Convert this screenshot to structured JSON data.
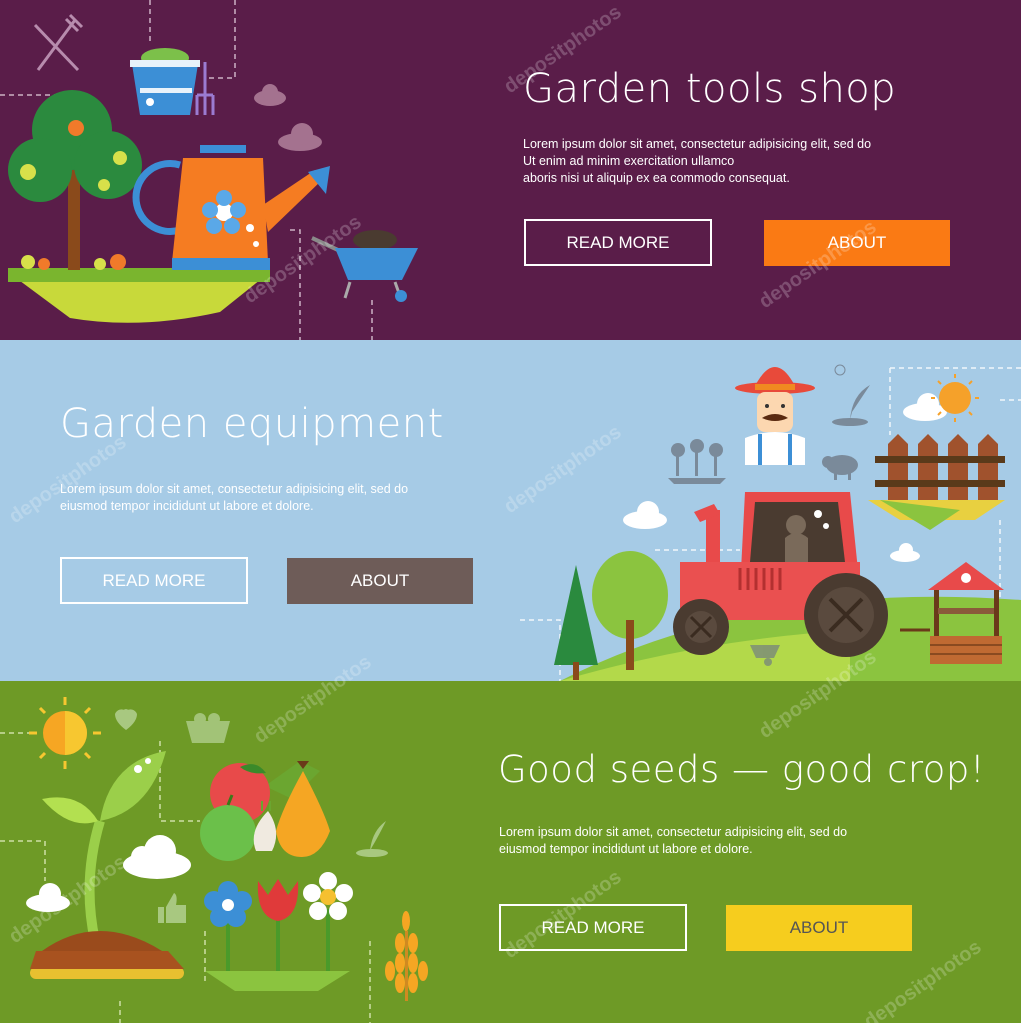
{
  "banners": [
    {
      "title": "Garden tools shop",
      "body": [
        "Lorem ipsum dolor sit amet, consectetur adipisicing elit, sed do",
        "Ut enim ad minim exercitation ullamco",
        "aboris nisi ut aliquip ex ea commodo consequat."
      ],
      "read_more": "READ MORE",
      "about": "ABOUT",
      "colors": {
        "background": "#5a1d49",
        "about_button": "#fa7a14"
      },
      "icons": [
        "tree-icon",
        "watering-can-icon",
        "bucket-icon",
        "pitchfork-icon",
        "wheelbarrow-icon",
        "cloud-icon",
        "shovel-rake-icon"
      ]
    },
    {
      "title": "Garden equipment",
      "body": [
        "Lorem ipsum dolor sit amet, consectetur adipisicing elit, sed do",
        "eiusmod tempor incididunt ut labore et dolore."
      ],
      "read_more": "READ MORE",
      "about": "ABOUT",
      "colors": {
        "background": "#a6cbe6",
        "about_button": "#6e5c58"
      },
      "icons": [
        "farmer-icon",
        "tractor-icon",
        "fence-icon",
        "well-icon",
        "tree-icon",
        "sun-icon",
        "cloud-icon",
        "flowers-icon",
        "sheep-icon",
        "sprout-icon"
      ]
    },
    {
      "title": "Good seeds — good crop!",
      "body": [
        "Lorem ipsum dolor sit amet, consectetur adipisicing elit, sed do",
        "eiusmod tempor incididunt ut labore et dolore."
      ],
      "read_more": "READ MORE",
      "about": "ABOUT",
      "colors": {
        "background": "#6e9a26",
        "about_button": "#f6cd1e"
      },
      "icons": [
        "sun-icon",
        "sprout-icon",
        "heart-icon",
        "vegetables-icon",
        "flowers-icon",
        "wheat-icon",
        "cloud-icon",
        "thumbs-up-icon"
      ]
    }
  ],
  "watermark": "depositphotos"
}
